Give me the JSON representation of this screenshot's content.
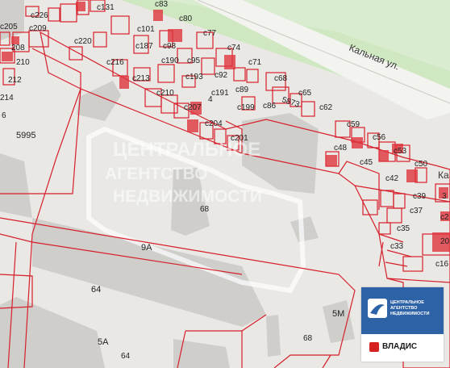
{
  "map": {
    "street_name": "Кальная ул.",
    "street_edge_fragment": "Ка",
    "watermark": [
      "ЦЕНТРАЛЬНОЕ",
      "АГЕНТСТВО",
      "НЕДВИЖИМОСТИ"
    ],
    "labels": {
      "c226": "c226",
      "c131": "c131",
      "c83": "c83",
      "c80": "c80",
      "c101": "c101",
      "c77": "c77",
      "c205": "c205",
      "c209": "c209",
      "c220": "c220",
      "c98": "c98",
      "c74": "c74",
      "c187": "c187",
      "c216": "c216",
      "c190": "c190",
      "c95": "c95",
      "c71": "c71",
      "c210a": "210",
      "c208": "208",
      "c213": "c213",
      "c193": "c193",
      "c92": "c92",
      "c68": "c68",
      "c89": "c89",
      "c65": "c65",
      "c212": "212",
      "c210": "c210",
      "c191": "c191",
      "n4": "4",
      "c214": "214",
      "n5873": "5873",
      "c62": "c62",
      "c207": "c207",
      "c199": "c199",
      "c86": "c86",
      "c204": "c204",
      "c201": "c201",
      "c59": "c59",
      "c56": "c56",
      "n5995": "5995",
      "c48": "c48",
      "c53": "c53",
      "c45": "c45",
      "c50": "c50",
      "c42": "c42",
      "c39": "c39",
      "c37": "c37",
      "c35": "c35",
      "c33": "c33",
      "c16": "c16",
      "c2": "c2",
      "n68a": "68",
      "n9A": "9А",
      "n64a": "64",
      "n5A": "5А",
      "n64b": "64",
      "n5M": "5М",
      "n68b": "68",
      "n3": "3",
      "n6": "6",
      "n20": "20"
    }
  },
  "logo": {
    "lines": [
      "ЦЕНТРАЛЬНОЕ",
      "АГЕНТСТВО",
      "НЕДВИЖИМОСТИ"
    ],
    "brand": "ВЛАДИС"
  },
  "colors": {
    "background": "#e9e8e4",
    "building": "#cfcecb",
    "parcel_line": "#d61f2b",
    "parcel_fill": "#e0353d",
    "road_green": "#cfe8c2",
    "logo_blue": "#2d62a6"
  }
}
